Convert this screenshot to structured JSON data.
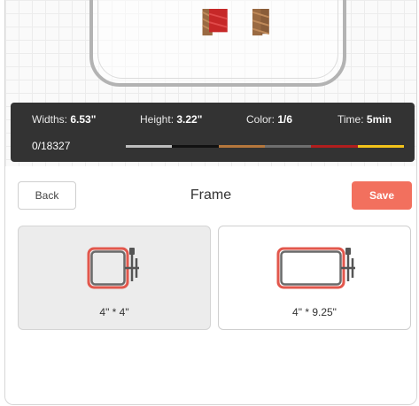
{
  "info": {
    "widths_label": "Widths: ",
    "widths_value": "6.53\"",
    "height_label": "Height: ",
    "height_value": "3.22\"",
    "color_label": "Color: ",
    "color_value": "1/6",
    "time_label": "Time: ",
    "time_value": "5min",
    "stitch_count": "0/18327"
  },
  "thread_colors": [
    "#bdbdbd",
    "#111111",
    "#b5773c",
    "#6f6f6f",
    "#b11e1e",
    "#f2c21a"
  ],
  "header": {
    "back_label": "Back",
    "title": "Frame",
    "save_label": "Save"
  },
  "frames": [
    {
      "label": "4\" * 4\"",
      "selected": true
    },
    {
      "label": "4\" * 9.25\"",
      "selected": false
    }
  ],
  "colors": {
    "accent": "#f2705e",
    "hoop_red": "#e2574c",
    "info_bar": "#333333"
  }
}
